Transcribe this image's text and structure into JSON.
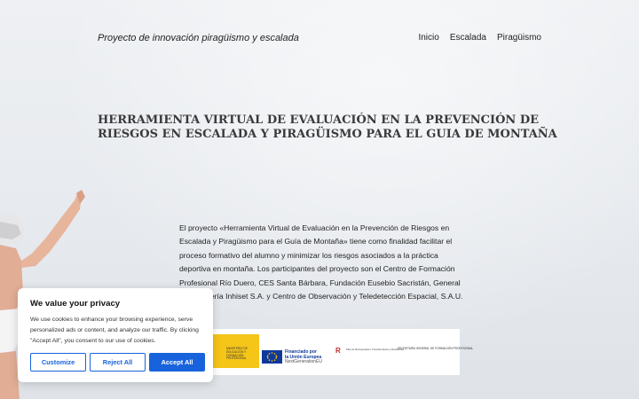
{
  "header": {
    "site_title": "Proyecto de innovación piragüismo y escalada",
    "nav": [
      "Inicio",
      "Escalada",
      "Piragüismo"
    ]
  },
  "main": {
    "headline": "HERRAMIENTA VIRTUAL DE EVALUACIÓN EN LA PREVENCIÓN DE RIESGOS EN ESCALADA Y PIRAGÜISMO PARA EL GUIA DE MONTAÑA",
    "body": "El proyecto «Herramienta Virtual de Evaluación en la Prevención de Riesgos en Escalada y Piragüismo para el Guía de Montaña» tiene como finalidad facilitar el proceso formativo del alumno y minimizar los riesgos asociados a la práctica deportiva en montaña. Los participantes del proyecto son el Centro de Formación Profesional Río Duero, CES Santa Bárbara, Fundación Eusebio Sacristán, General de ingeniería Inhiset S.A. y Centro de Observación y Teledetección Espacial, S.A.U."
  },
  "logos": {
    "ministerio": "MINISTERIO DE EDUCACIÓN Y FORMACIÓN PROFESIONAL",
    "eu_line1": "Financiado por",
    "eu_line2": "la Unión Europea",
    "eu_line3": "NextGenerationEU",
    "prtr": "Plan de Recuperación, Transformación y Resiliencia",
    "secretaria": "SECRETARÍA GENERAL DE FORMACIÓN PROFESIONAL"
  },
  "cookie": {
    "title": "We value your privacy",
    "message": "We use cookies to enhance your browsing experience, serve personalized ads or content, and analyze our traffic. By clicking \"Accept All\", you consent to our use of cookies.",
    "customize": "Customize",
    "reject": "Reject All",
    "accept": "Accept All"
  },
  "colors": {
    "accent": "#1863dc",
    "eu_blue": "#10399b",
    "ministerio_yellow": "#f5c518"
  }
}
